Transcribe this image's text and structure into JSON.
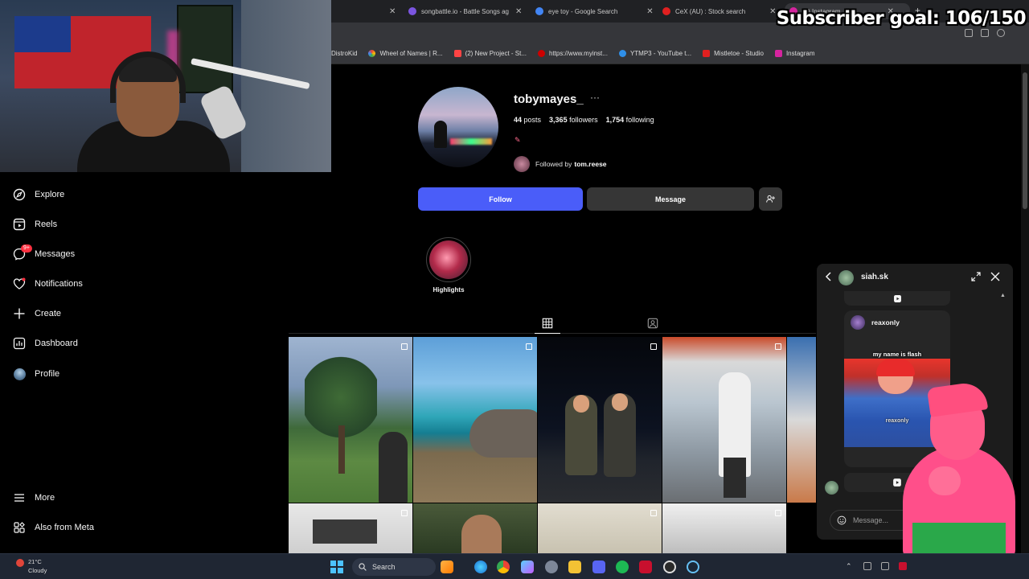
{
  "browser": {
    "tabs": [
      {
        "title": "songbattle.io - Battle Songs ag",
        "fav_color": "#7b55e0"
      },
      {
        "title": "eye toy - Google Search",
        "fav_color": "#4285f4"
      },
      {
        "title": "CeX (AU) : Stock search",
        "fav_color": "#e02020"
      },
      {
        "title": "(9) Instagram",
        "fav_color": "#d6249f",
        "active": true
      }
    ],
    "new_tab": "+",
    "bookmarks": [
      {
        "label": "DistroKid",
        "color": "#ffffff"
      },
      {
        "label": "Wheel of Names | R...",
        "color": "#34a853"
      },
      {
        "label": "(2) New Project - St...",
        "color": "#ff4444"
      },
      {
        "label": "https://www.myinst...",
        "color": "#cc0000"
      },
      {
        "label": "YTMP3 - YouTube t...",
        "color": "#2f8fe8"
      },
      {
        "label": "Mistletoe - Studio",
        "color": "#e02020"
      },
      {
        "label": "Instagram",
        "color": "#d6249f"
      }
    ]
  },
  "overlay": {
    "subscriber_goal": "Subscriber goal: 106/150"
  },
  "sidebar": {
    "items": [
      {
        "label": "Explore",
        "icon": "compass-icon"
      },
      {
        "label": "Reels",
        "icon": "reels-icon"
      },
      {
        "label": "Messages",
        "icon": "messenger-icon",
        "badge": "9+"
      },
      {
        "label": "Notifications",
        "icon": "heart-icon"
      },
      {
        "label": "Create",
        "icon": "plus-icon"
      },
      {
        "label": "Dashboard",
        "icon": "chart-icon"
      },
      {
        "label": "Profile",
        "icon": "avatar"
      }
    ],
    "more": "More",
    "meta": "Also from Meta"
  },
  "profile": {
    "username": "tobymayes_",
    "more": "···",
    "posts_count": "44",
    "posts_label": "posts",
    "followers_count": "3,365",
    "followers_label": "followers",
    "following_count": "1,754",
    "following_label": "following",
    "followed_by_prefix": "Followed by",
    "followed_by_user": "tom.reese",
    "follow": "Follow",
    "message": "Message",
    "highlight_label": "Highlights"
  },
  "dm": {
    "name": "siah.sk",
    "share_user": "reaxonly",
    "caption": "my name is flash",
    "watermark": "reaxonly",
    "input_placeholder": "Message..."
  },
  "taskbar": {
    "temp": "21°C",
    "condition": "Cloudy",
    "search_placeholder": "Search"
  },
  "colors": {
    "accent": "#4a5df9",
    "background": "#000000",
    "badge": "#ff3040"
  }
}
